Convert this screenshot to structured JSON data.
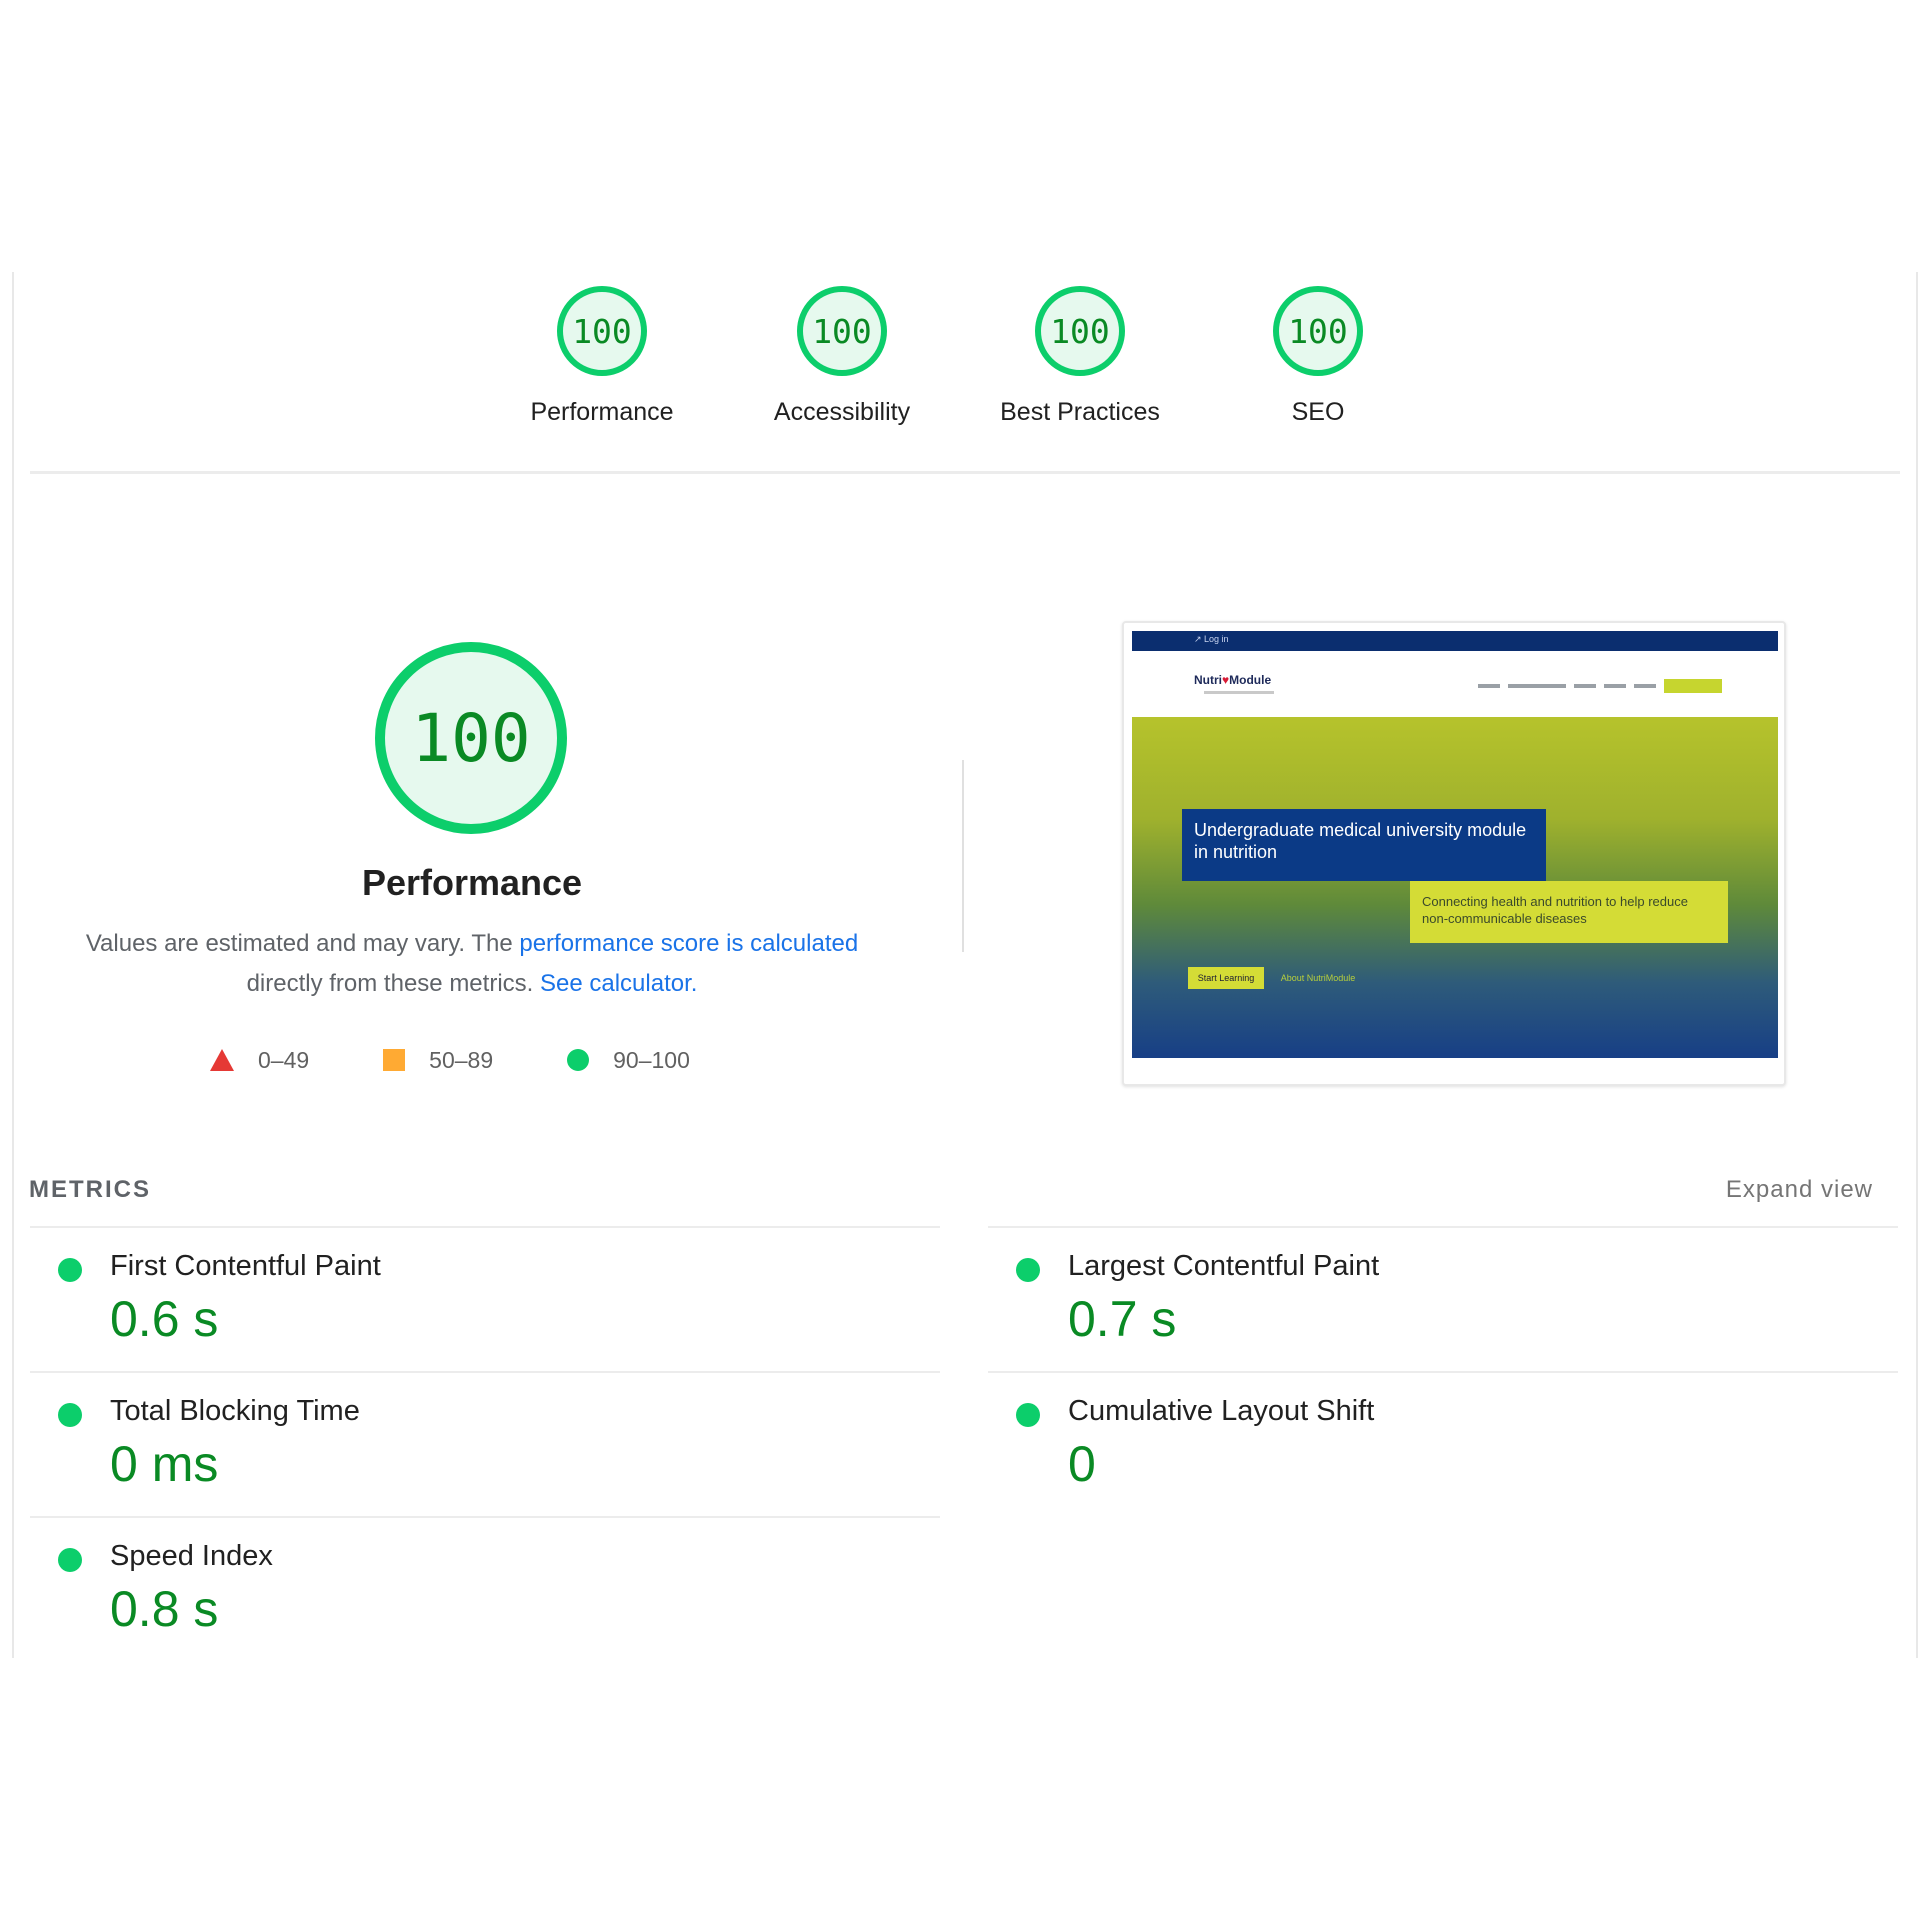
{
  "categories": [
    {
      "score": "100",
      "label": "Performance"
    },
    {
      "score": "100",
      "label": "Accessibility"
    },
    {
      "score": "100",
      "label": "Best Practices"
    },
    {
      "score": "100",
      "label": "SEO"
    }
  ],
  "performance": {
    "score": "100",
    "title": "Performance",
    "desc_prefix": "Values are estimated and may vary. The ",
    "desc_link1": "performance score is calculated",
    "desc_middle": " directly from these metrics. ",
    "desc_link2": "See calculator."
  },
  "legend": [
    {
      "icon": "triangle-icon",
      "range": "0–49",
      "color": "#e53935"
    },
    {
      "icon": "square-icon",
      "range": "50–89",
      "color": "#ffaa33"
    },
    {
      "icon": "circle-icon",
      "range": "90–100",
      "color": "#0cce6b"
    }
  ],
  "thumbnail": {
    "topbar_text": "↗ Log in",
    "logo_text": "Nutri",
    "logo_text2": "Module",
    "hero_title": "Undergraduate medical university module in nutrition",
    "hero_sub": "Connecting health and nutrition to help reduce non-communicable diseases",
    "btn1": "Start Learning",
    "btn2": "About NutriModule"
  },
  "metrics": {
    "title": "METRICS",
    "expand": "Expand view",
    "items": [
      {
        "name": "First Contentful Paint",
        "value": "0.6 s"
      },
      {
        "name": "Largest Contentful Paint",
        "value": "0.7 s"
      },
      {
        "name": "Total Blocking Time",
        "value": "0 ms"
      },
      {
        "name": "Cumulative Layout Shift",
        "value": "0"
      },
      {
        "name": "Speed Index",
        "value": "0.8 s"
      }
    ]
  },
  "colors": {
    "pass": "#0cce6b",
    "pass_text": "#0a8a24",
    "link": "#1a73e8"
  }
}
